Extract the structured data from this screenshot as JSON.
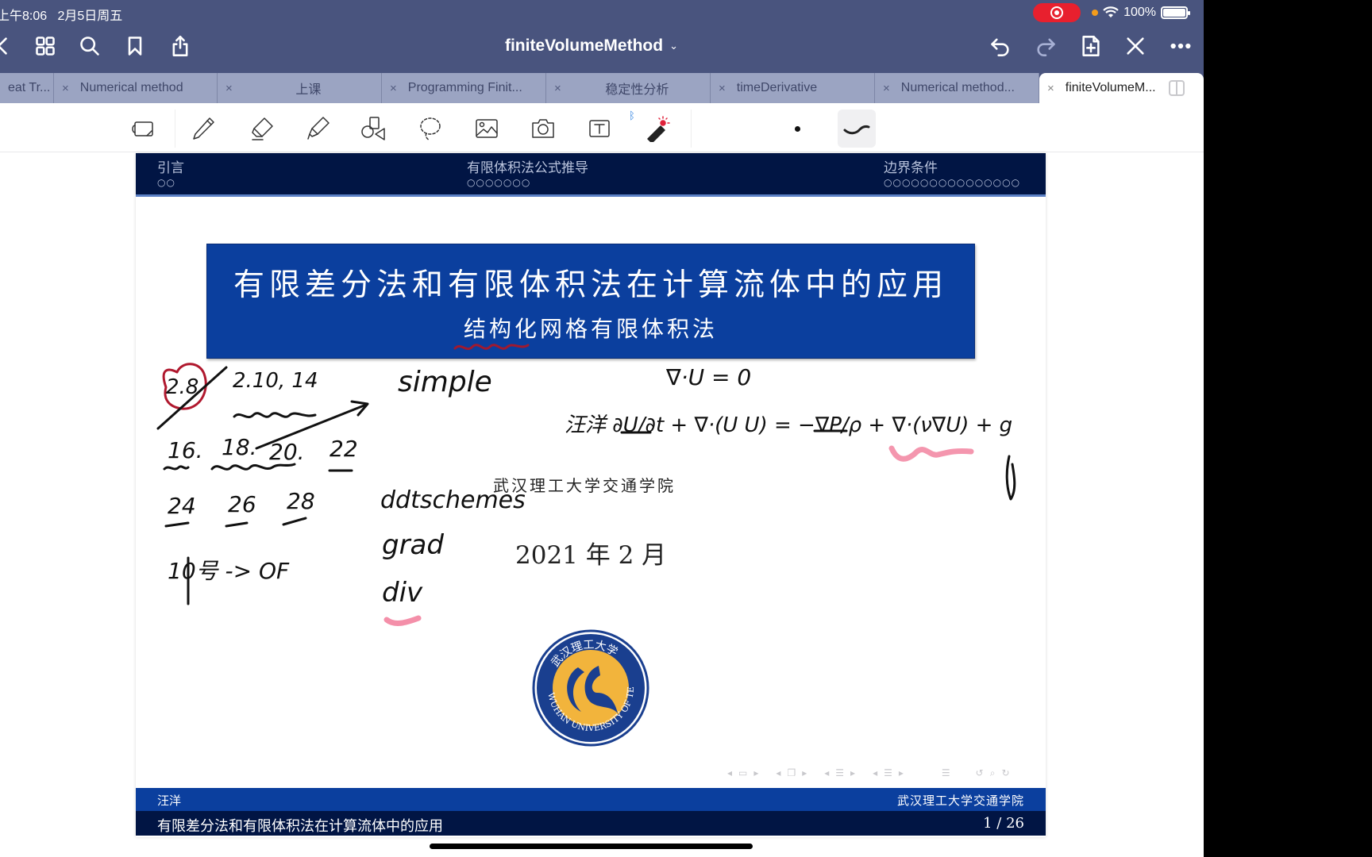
{
  "status_bar": {
    "time": "上午8:06",
    "date": "2月5日周五",
    "battery": "100%",
    "recording": true
  },
  "nav_bar": {
    "title": "finiteVolumeMethod",
    "left_icons": [
      "back-icon",
      "grid-icon",
      "search-icon",
      "bookmark-icon",
      "share-icon"
    ],
    "right_icons": [
      "undo-icon",
      "redo-icon",
      "add-page-icon",
      "close-edit-icon",
      "more-icon"
    ]
  },
  "tabs": [
    {
      "label": "eat Tr...",
      "active": false,
      "closable": false
    },
    {
      "label": "Numerical method",
      "active": false
    },
    {
      "label": "上课",
      "active": false
    },
    {
      "label": "Programming Finit...",
      "active": false
    },
    {
      "label": "稳定性分析",
      "active": false
    },
    {
      "label": "timeDerivative",
      "active": false
    },
    {
      "label": "Numerical method...",
      "active": false
    },
    {
      "label": "finiteVolumeM...",
      "active": true
    }
  ],
  "tab_close_glyph": "×",
  "toolbar": {
    "tools": [
      "read-mode",
      "pen",
      "eraser",
      "highlighter",
      "shapes",
      "lasso",
      "image",
      "camera",
      "text",
      "laser-pointer"
    ],
    "stroke_width_indicator": "•"
  },
  "slide": {
    "header_sections": [
      {
        "label": "引言",
        "dots": "○○"
      },
      {
        "label": "有限体积法公式推导",
        "dots": "○○○○○○○"
      },
      {
        "label": "边界条件",
        "dots": "○○○○○○○○○○○○○○○"
      }
    ],
    "title": "有限差分法和有限体积法在计算流体中的应用",
    "subtitle": "结构化网格有限体积法",
    "institute": "武汉理工大学交通学院",
    "date": "2021 年 2 月",
    "logo_text": "WUHAN UNIVERSITY OF TECHNOLOGY",
    "logo_cn": "武汉理工大学",
    "footer": {
      "author": "汪洋",
      "institute": "武汉理工大学交通学院",
      "title": "有限差分法和有限体积法在计算流体中的应用",
      "page": "1 / 26"
    }
  },
  "handwriting": {
    "left_notes": [
      "2.8",
      "2.10, 14",
      "simple",
      "16.",
      "18.",
      "20.",
      "22",
      "24",
      "26",
      "28",
      "10号 -> OF"
    ],
    "middle_notes": [
      "ddtschemes",
      "grad",
      "div"
    ],
    "equations": [
      "∇·U = 0",
      "汪洋 ∂U/∂t + ∇·(U U) = −∇P/ρ + ∇·(ν∇U) + g"
    ]
  },
  "colors": {
    "nav_bg": "#49547e",
    "tab_bg": "#9ba4c2",
    "slide_header": "#011544",
    "slide_blue": "#0b3f9e",
    "record_red": "#e8202e",
    "ink_highlight": "#f06a8c",
    "ink_red": "#b0182e"
  }
}
